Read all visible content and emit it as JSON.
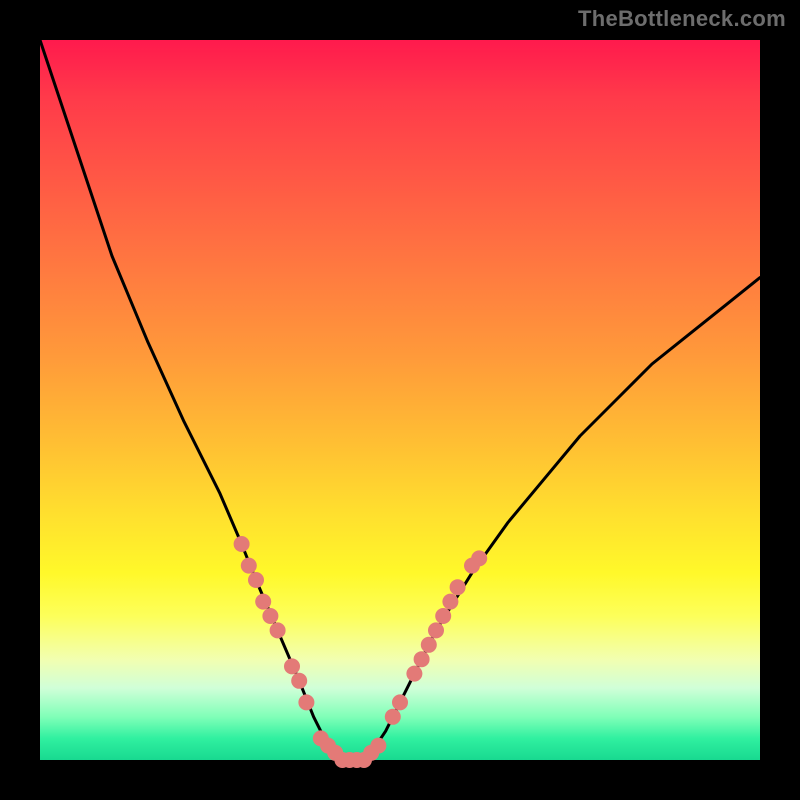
{
  "watermark": "TheBottleneck.com",
  "chart_data": {
    "type": "line",
    "title": "",
    "xlabel": "",
    "ylabel": "",
    "xlim": [
      0,
      100
    ],
    "ylim": [
      0,
      100
    ],
    "grid": false,
    "series": [
      {
        "name": "bottleneck-curve",
        "x": [
          0,
          5,
          10,
          15,
          20,
          25,
          28,
          30,
          33,
          36,
          38,
          40,
          42,
          44,
          46,
          48,
          50,
          55,
          60,
          65,
          70,
          75,
          80,
          85,
          90,
          95,
          100
        ],
        "values": [
          100,
          85,
          70,
          58,
          47,
          37,
          30,
          25,
          18,
          11,
          6,
          2,
          0,
          0,
          1,
          4,
          8,
          18,
          26,
          33,
          39,
          45,
          50,
          55,
          59,
          63,
          67
        ]
      }
    ],
    "markers": {
      "name": "highlighted-points",
      "color": "#e37a77",
      "points": [
        {
          "x": 28,
          "y": 30
        },
        {
          "x": 29,
          "y": 27
        },
        {
          "x": 30,
          "y": 25
        },
        {
          "x": 31,
          "y": 22
        },
        {
          "x": 32,
          "y": 20
        },
        {
          "x": 33,
          "y": 18
        },
        {
          "x": 35,
          "y": 13
        },
        {
          "x": 36,
          "y": 11
        },
        {
          "x": 37,
          "y": 8
        },
        {
          "x": 39,
          "y": 3
        },
        {
          "x": 40,
          "y": 2
        },
        {
          "x": 41,
          "y": 1
        },
        {
          "x": 42,
          "y": 0
        },
        {
          "x": 43,
          "y": 0
        },
        {
          "x": 44,
          "y": 0
        },
        {
          "x": 45,
          "y": 0
        },
        {
          "x": 46,
          "y": 1
        },
        {
          "x": 47,
          "y": 2
        },
        {
          "x": 49,
          "y": 6
        },
        {
          "x": 50,
          "y": 8
        },
        {
          "x": 52,
          "y": 12
        },
        {
          "x": 53,
          "y": 14
        },
        {
          "x": 54,
          "y": 16
        },
        {
          "x": 55,
          "y": 18
        },
        {
          "x": 56,
          "y": 20
        },
        {
          "x": 57,
          "y": 22
        },
        {
          "x": 58,
          "y": 24
        },
        {
          "x": 60,
          "y": 27
        },
        {
          "x": 61,
          "y": 28
        }
      ]
    },
    "background_gradient": {
      "top": "#ff1a4d",
      "mid": "#fff82a",
      "bottom": "#18d990"
    }
  }
}
